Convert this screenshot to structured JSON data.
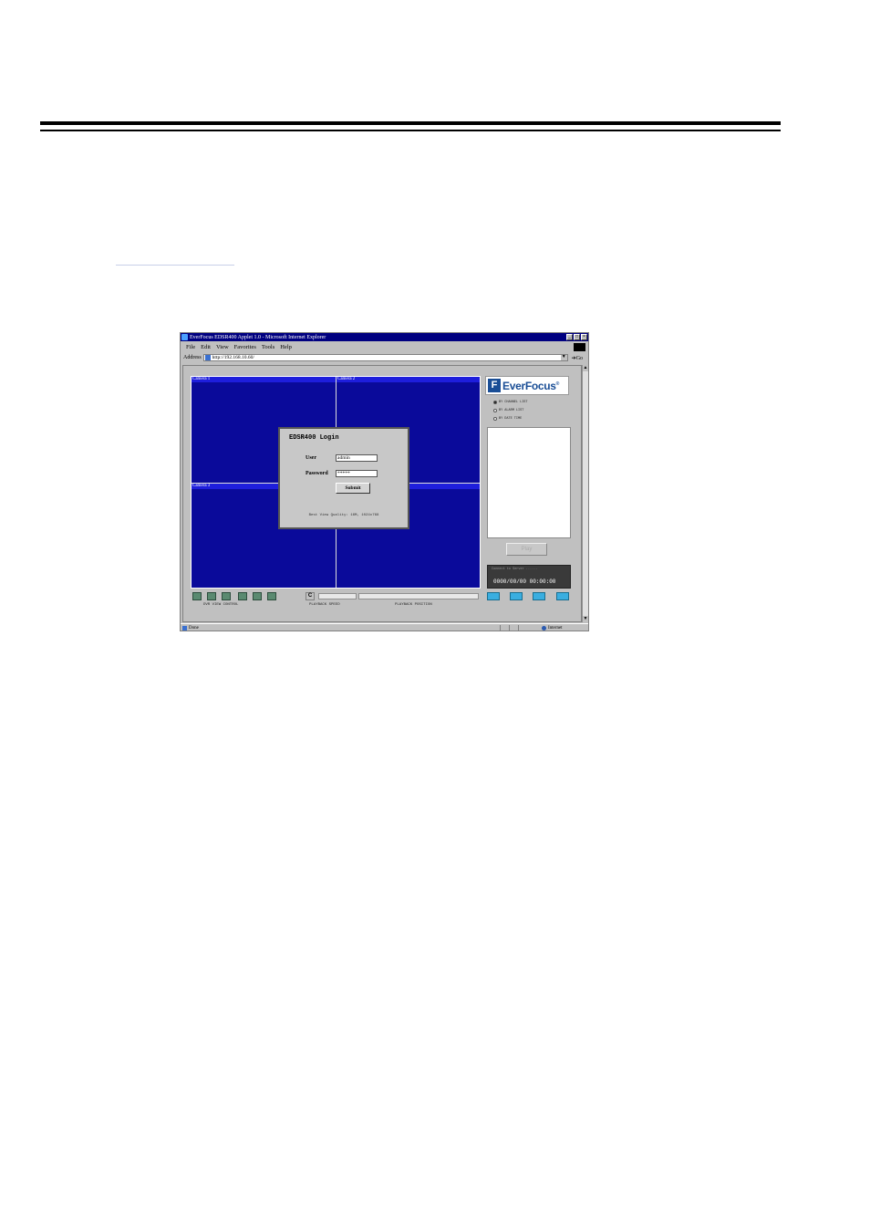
{
  "window": {
    "title": "EverFocus EDSR400 Applet 1.0 - Microsoft Internet Explorer",
    "controls": [
      "_",
      "□",
      "×"
    ]
  },
  "menu": [
    "File",
    "Edit",
    "View",
    "Favorites",
    "Tools",
    "Help"
  ],
  "address": {
    "label": "Address",
    "url": "http://192.168.10.60/",
    "go_label": "Go"
  },
  "cameras": [
    "Camera 1",
    "Camera 2",
    "Camera 3",
    "Camera 4"
  ],
  "login": {
    "title": "EDSR400 Login",
    "user_label": "User",
    "user_value": "admin",
    "password_label": "Password",
    "password_value": "*****",
    "submit_label": "Submit",
    "note": "Best View Quality: 16M, 1024x768"
  },
  "controls": {
    "c_button": "C",
    "labels": [
      "DVR VIEW CONTROL",
      "PLAYBACK SPEED",
      "PLAYBACK POSITION"
    ]
  },
  "logo": {
    "text": "EverFocus",
    "mark": "F",
    "reg": "®"
  },
  "list_options": [
    {
      "label": "BY CHANNEL LIST",
      "selected": true
    },
    {
      "label": "BY ALARM LIST",
      "selected": false
    },
    {
      "label": "BY DATE TIME",
      "selected": false
    }
  ],
  "play_button": "Play",
  "status_panel": {
    "message": "Connect to Server ......",
    "datetime": "0000/00/00 00:00:00"
  },
  "statusbar": {
    "left": "Done",
    "zone": "Internet"
  },
  "colors": {
    "title_bg": "#000080",
    "camera_bg": "#0a0a9a",
    "accent": "#1a4e96"
  }
}
